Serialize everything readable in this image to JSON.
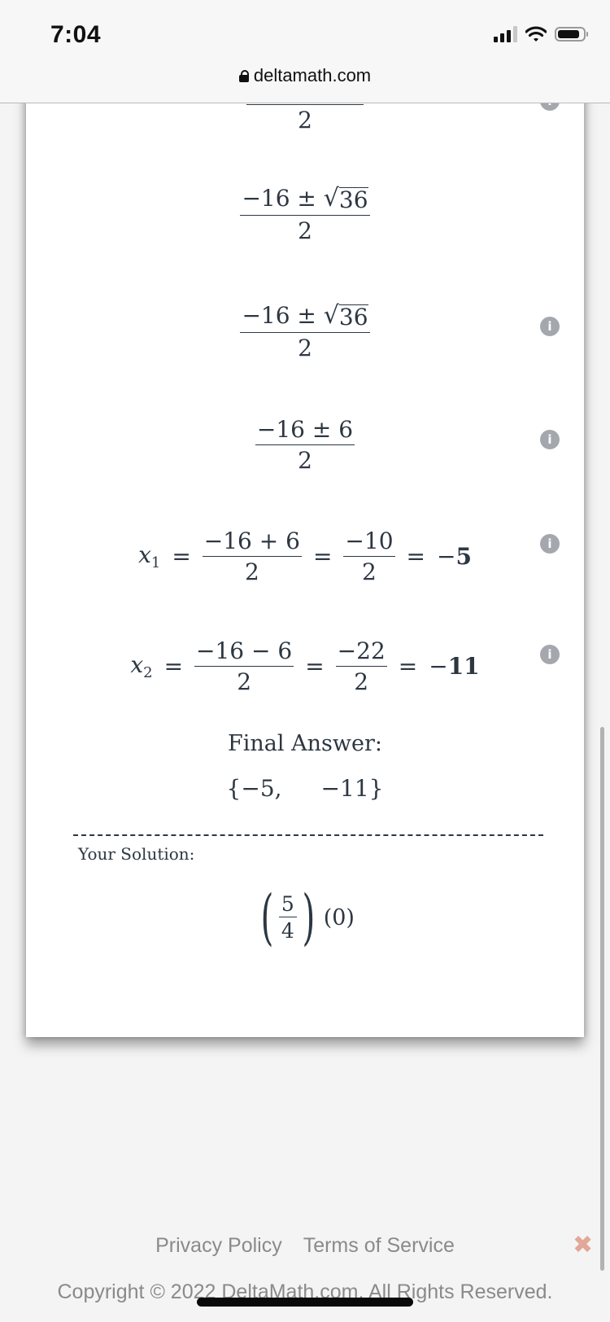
{
  "status_bar": {
    "time": "7:04",
    "signal_icon": "cellular-signal-icon",
    "wifi_icon": "wifi-icon",
    "battery_icon": "battery-icon"
  },
  "browser": {
    "url": "deltamath.com",
    "lock_icon": "lock-icon"
  },
  "solution_steps": [
    {
      "type": "fraction",
      "numerator": "",
      "denominator": "2",
      "info_icon": true
    },
    {
      "type": "fraction-sqrt",
      "numerator_prefix": "−16 ±",
      "radicand": "36",
      "denominator": "2",
      "info_icon": false
    },
    {
      "type": "fraction-sqrt",
      "numerator_prefix": "−16 ±",
      "radicand": "36",
      "denominator": "2",
      "info_icon": true
    },
    {
      "type": "fraction",
      "numerator": "−16 ± 6",
      "denominator": "2",
      "info_icon": true
    },
    {
      "type": "root",
      "var": "x",
      "sub": "1",
      "eq": "=",
      "frac1_num": "−16 + 6",
      "frac1_den": "2",
      "frac2_num": "−10",
      "frac2_den": "2",
      "result_sign": "−",
      "result": "5",
      "info_icon": true
    },
    {
      "type": "root",
      "var": "x",
      "sub": "2",
      "eq": "=",
      "frac1_num": "−16 − 6",
      "frac1_den": "2",
      "frac2_num": "−22",
      "frac2_den": "2",
      "result_sign": "−",
      "result": "11",
      "info_icon": true
    }
  ],
  "info_icon_glyph": "i",
  "final_answer": {
    "label": "Final Answer:",
    "open": "{",
    "value1": "−5,",
    "value2": "−11",
    "close": "}"
  },
  "your_solution": {
    "label": "Your Solution:",
    "frac_num": "5",
    "frac_den": "4",
    "paren_open": "(",
    "paren_close": ")",
    "second_factor": "(0)"
  },
  "footer": {
    "privacy": "Privacy Policy",
    "terms": "Terms of Service",
    "copyright": "Copyright © 2022 DeltaMath.com. All Rights Reserved.",
    "close_glyph": "✖"
  },
  "colors": {
    "math_text": "#2d3742",
    "info_icon": "#a4a8ae",
    "footer_text": "#8a8a8a",
    "close_accent": "#e2a797"
  }
}
